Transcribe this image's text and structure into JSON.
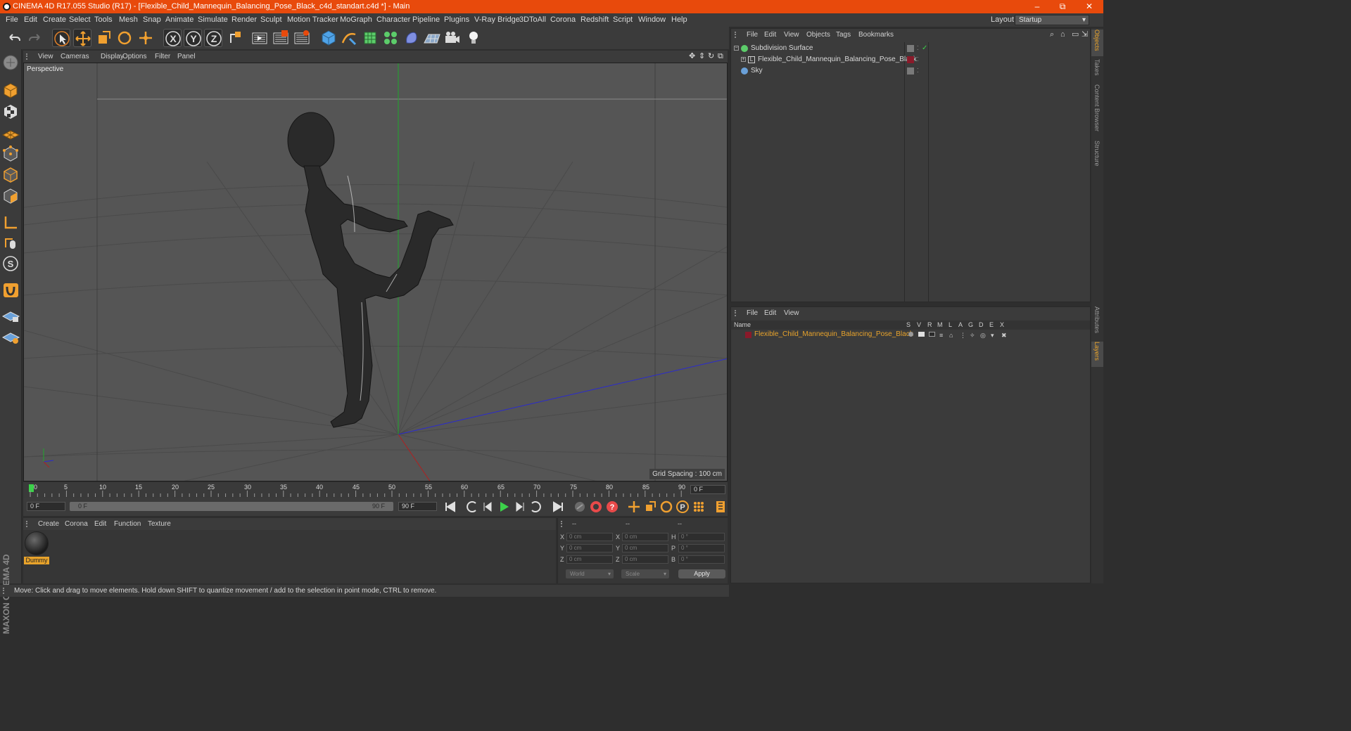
{
  "window": {
    "title": "CINEMA 4D R17.055 Studio (R17) - [Flexible_Child_Mannequin_Balancing_Pose_Black_c4d_standart.c4d *] - Main",
    "minimize": "–",
    "maximize": "⧉",
    "close": "✕"
  },
  "menu": {
    "items": [
      "File",
      "Edit",
      "Create",
      "Select",
      "Tools",
      "Mesh",
      "Snap",
      "Animate",
      "Simulate",
      "Render",
      "Sculpt",
      "Motion Tracker",
      "MoGraph",
      "Character",
      "Pipeline",
      "Plugins",
      "V-Ray Bridge",
      "3DToAll",
      "Corona",
      "Redshift",
      "Script",
      "Window",
      "Help"
    ],
    "layout_label": "Layout:",
    "layout_value": "Startup"
  },
  "viewport": {
    "menu": [
      "View",
      "Cameras",
      "Display",
      "Options",
      "Filter",
      "Panel"
    ],
    "label": "Perspective",
    "grid_spacing": "Grid Spacing : 100 cm"
  },
  "timeline": {
    "ticks": [
      "0",
      "5",
      "10",
      "15",
      "20",
      "25",
      "30",
      "35",
      "40",
      "45",
      "50",
      "55",
      "60",
      "65",
      "70",
      "75",
      "80",
      "85",
      "90"
    ],
    "current_frame": "0 F"
  },
  "transport": {
    "start_field": "0 F",
    "range_start": "0 F",
    "range_end": "90 F",
    "end_field": "90 F"
  },
  "material_manager": {
    "menu": [
      "Create",
      "Corona",
      "Edit",
      "Function",
      "Texture"
    ],
    "material_name": "Dummy"
  },
  "coordinates": {
    "headers": [
      "--",
      "--",
      "--"
    ],
    "rows": [
      {
        "axis": "X",
        "pos": "0 cm",
        "size_axis": "X",
        "size": "0 cm",
        "rot_axis": "H",
        "rot": "0 °"
      },
      {
        "axis": "Y",
        "pos": "0 cm",
        "size_axis": "Y",
        "size": "0 cm",
        "rot_axis": "P",
        "rot": "0 °"
      },
      {
        "axis": "Z",
        "pos": "0 cm",
        "size_axis": "Z",
        "size": "0 cm",
        "rot_axis": "B",
        "rot": "0 °"
      }
    ],
    "space": "World",
    "mode": "Scale",
    "apply": "Apply"
  },
  "status": "Move: Click and drag to move elements. Hold down SHIFT to quantize movement / add to the selection in point mode, CTRL to remove.",
  "object_manager": {
    "menu": [
      "File",
      "Edit",
      "View",
      "Objects",
      "Tags",
      "Bookmarks"
    ],
    "objects": [
      {
        "name": "Subdivision Surface"
      },
      {
        "name": "Flexible_Child_Mannequin_Balancing_Pose_Black"
      },
      {
        "name": "Sky"
      }
    ]
  },
  "layer_manager": {
    "menu": [
      "File",
      "Edit",
      "View"
    ],
    "columns": [
      "Name",
      "S",
      "V",
      "R",
      "M",
      "L",
      "A",
      "G",
      "D",
      "E",
      "X"
    ],
    "layer_name": "Flexible_Child_Mannequin_Balancing_Pose_Black"
  },
  "side_tabs": [
    "Objects",
    "Takes",
    "Content Browser",
    "Structure",
    "Attributes",
    "Layers"
  ],
  "brand": "MAXON CINEMA 4D",
  "colors": {
    "accent": "#e84a0c",
    "highlight": "#e8a32b"
  }
}
